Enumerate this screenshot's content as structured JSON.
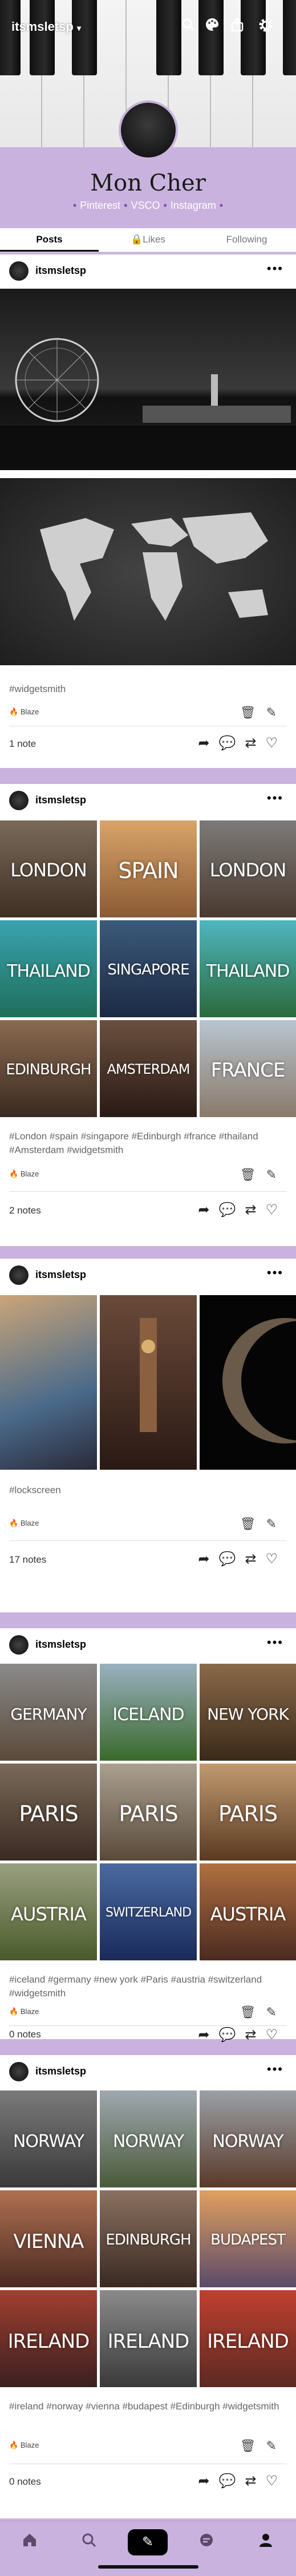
{
  "header": {
    "blog_switcher": "itsmsletsp",
    "title": "Mon Cher",
    "links": [
      "Pinterest",
      "VSCO",
      "Instagram"
    ]
  },
  "tabs": [
    {
      "label": "Posts",
      "active": true
    },
    {
      "label": "Likes",
      "locked": true
    },
    {
      "label": "Following"
    }
  ],
  "posts": [
    {
      "user": "itsmsletsp",
      "tags": "#widgetsmith",
      "blaze": "Blaze",
      "notes": "1 note"
    },
    {
      "user": "itsmsletsp",
      "tags": "#London #spain #singapore #Edinburgh #france #thailand #Amsterdam #widgetsmith",
      "blaze": "Blaze",
      "notes": "2 notes",
      "labels": [
        "LONDON",
        "SPAIN",
        "LONDON",
        "THAILAND",
        "SINGAPORE",
        "THAILAND",
        "EDINBURGH",
        "AMSTERDAM",
        "FRANCE"
      ]
    },
    {
      "user": "itsmsletsp",
      "tags": "#lockscreen",
      "blaze": "Blaze",
      "notes": "17 notes"
    },
    {
      "user": "itsmsletsp",
      "tags": "#iceland #germany #new york #Paris #austria #switzerland #widgetsmith",
      "blaze": "Blaze",
      "notes": "0 notes",
      "labels": [
        "GERMANY",
        "ICELAND",
        "NEW YORK",
        "PARIS",
        "PARIS",
        "PARIS",
        "AUSTRIA",
        "SWITZERLAND",
        "AUSTRIA"
      ]
    },
    {
      "user": "itsmsletsp",
      "tags": "#ireland #norway #vienna #budapest #Edinburgh #widgetsmith",
      "blaze": "Blaze",
      "notes": "0 notes",
      "labels": [
        "NORWAY",
        "NORWAY",
        "NORWAY",
        "VIENNA",
        "EDINBURGH",
        "BUDAPEST",
        "IRELAND",
        "IRELAND",
        "IRELAND"
      ]
    }
  ],
  "colors": {
    "accent": "#c9b3de",
    "link": "#7a4ba0"
  },
  "icons": {
    "top": [
      "chevron-down-icon",
      "search-icon",
      "palette-icon",
      "share-icon",
      "gear-icon"
    ],
    "post_actions": [
      "share-icon",
      "reply-icon",
      "reblog-icon",
      "heart-icon"
    ],
    "post_edit": [
      "delete-icon",
      "edit-icon"
    ],
    "nav": [
      "home-icon",
      "search-icon",
      "compose-icon",
      "activity-icon",
      "profile-icon"
    ]
  }
}
